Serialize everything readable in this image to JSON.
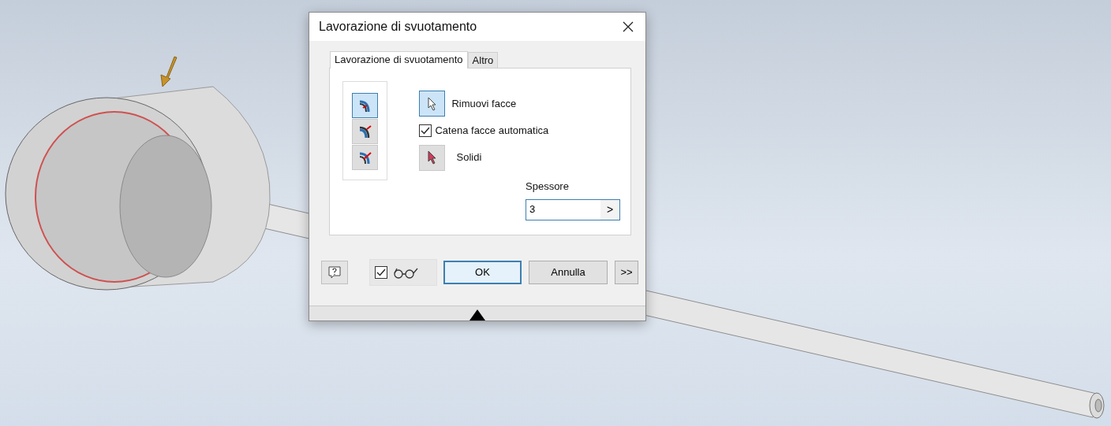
{
  "dialog": {
    "title": "Lavorazione di svuotamento",
    "tabs": [
      {
        "label": "Lavorazione di svuotamento",
        "selected": true
      },
      {
        "label": "Altro",
        "selected": false
      }
    ],
    "direction_buttons": [
      {
        "selected": true
      },
      {
        "selected": false
      },
      {
        "selected": false
      }
    ],
    "options": [
      {
        "kind": "select",
        "label": "Rimuovi facce",
        "selected": true
      },
      {
        "kind": "checkbox",
        "label": "Catena facce automatica",
        "checked": true
      },
      {
        "kind": "select",
        "label": "Solidi",
        "selected": false
      }
    ],
    "thickness": {
      "label": "Spessore",
      "value": "3",
      "arrow": ">"
    },
    "preview": {
      "checked": true
    },
    "buttons": [
      {
        "kind": "ok",
        "label": "OK"
      },
      {
        "kind": "cancel",
        "label": "Annulla"
      },
      {
        "kind": "more",
        "label": ">>"
      }
    ]
  }
}
